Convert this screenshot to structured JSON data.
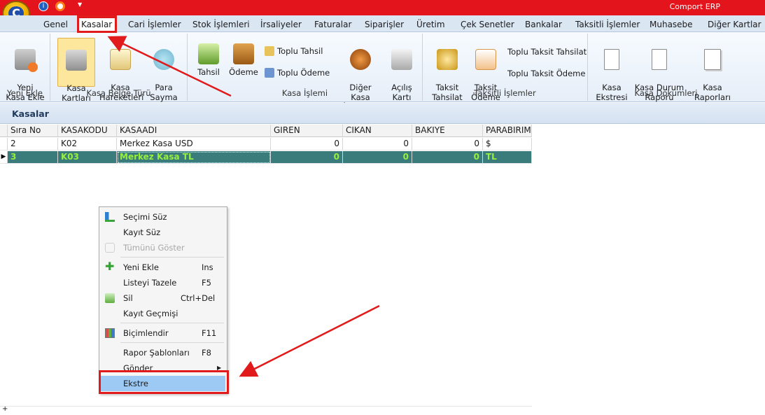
{
  "app": {
    "title": "Comport ERP",
    "logo_letter": "C"
  },
  "tabs": [
    "Genel",
    "Kasalar",
    "Cari İşlemler",
    "Stok İşlemleri",
    "İrsaliyeler",
    "Faturalar",
    "Siparişler",
    "Üretim",
    "Çek Senetler",
    "Bankalar",
    "Taksitli İşlemler",
    "Muhasebe",
    "Diğer Kartlar"
  ],
  "active_tab": "Kasalar",
  "ribbon": {
    "groups": [
      {
        "label": "Yeni Ekle",
        "buttons": [
          "Yeni\nKasa Ekle"
        ]
      },
      {
        "label": "Kasa Belge Türü",
        "buttons": [
          "Kasa\nKartları",
          "Kasa\nHareketleri",
          "Para\nSayma"
        ]
      },
      {
        "label": "Kasa İşlemi",
        "buttons": [
          "Tahsil",
          "Ödeme",
          "Toplu Tahsil",
          "Toplu Ödeme",
          "Diğer Kasa\nİşlemleri",
          "Açılış\nKartı"
        ]
      },
      {
        "label": "Taksitli İşlemler",
        "buttons": [
          "Taksit\nTahsilat",
          "Taksit\nÖdeme",
          "Toplu Taksit Tahsilat",
          "Toplu Taksit Ödeme"
        ]
      },
      {
        "label": "Kasa Dökümleri",
        "buttons": [
          "Kasa\nEkstresi",
          "Kasa Durum\nRaporu",
          "Kasa\nRaporları"
        ]
      }
    ]
  },
  "section_title": "Kasalar",
  "grid": {
    "columns": [
      "Sıra No",
      "KASAKODU",
      "KASAADI",
      "GIREN",
      "CIKAN",
      "BAKIYE",
      "PARABIRIMI"
    ],
    "rows": [
      [
        "2",
        "K02",
        "Merkez Kasa USD",
        "0",
        "0",
        "0",
        "$"
      ],
      [
        "3",
        "K03",
        "Merkez Kasa TL",
        "0",
        "0",
        "0",
        "TL"
      ]
    ],
    "selected_row": 1
  },
  "context_menu": {
    "items": [
      {
        "label": "Seçimi Süz",
        "key": ""
      },
      {
        "label": "Kayıt Süz",
        "key": ""
      },
      {
        "label": "Tümünü Göster",
        "key": "",
        "disabled": true
      },
      {
        "label": "Yeni Ekle",
        "key": "Ins"
      },
      {
        "label": "Listeyi Tazele",
        "key": "F5"
      },
      {
        "label": "Sil",
        "key": "Ctrl+Del"
      },
      {
        "label": "Kayıt Geçmişi",
        "key": ""
      },
      {
        "label": "Biçimlendir",
        "key": "F11"
      },
      {
        "label": "Rapor Şablonları",
        "key": "F8"
      },
      {
        "label": "Gönder",
        "key": ""
      },
      {
        "label": "Ekstre",
        "key": "",
        "highlighted": true
      }
    ]
  },
  "colors": {
    "title_bar": "#e3141b",
    "selected_row_bg": "#3a7c7c",
    "selected_row_text": "#98f03c",
    "highlight": "#e11b1b",
    "menu_hover": "#9ccaf5"
  }
}
